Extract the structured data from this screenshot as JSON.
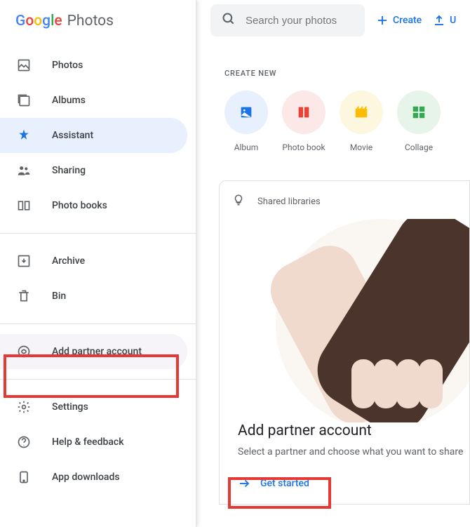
{
  "brand": {
    "name": "Photos"
  },
  "search": {
    "placeholder": "Search your photos"
  },
  "topbar": {
    "create": "Create",
    "upload": "U"
  },
  "sidebar": {
    "main": [
      {
        "label": "Photos"
      },
      {
        "label": "Albums"
      },
      {
        "label": "Assistant"
      },
      {
        "label": "Sharing"
      },
      {
        "label": "Photo books"
      }
    ],
    "secondary": [
      {
        "label": "Archive"
      },
      {
        "label": "Bin"
      }
    ],
    "partner": {
      "label": "Add partner account"
    },
    "footer": [
      {
        "label": "Settings"
      },
      {
        "label": "Help & feedback"
      },
      {
        "label": "App downloads"
      }
    ]
  },
  "create_new": {
    "header": "CREATE NEW",
    "items": [
      {
        "label": "Album"
      },
      {
        "label": "Photo book"
      },
      {
        "label": "Movie"
      },
      {
        "label": "Collage"
      }
    ]
  },
  "card": {
    "hint": "Shared libraries",
    "title": "Add partner account",
    "desc": "Select a partner and choose what you want to share",
    "action": "Get started"
  }
}
